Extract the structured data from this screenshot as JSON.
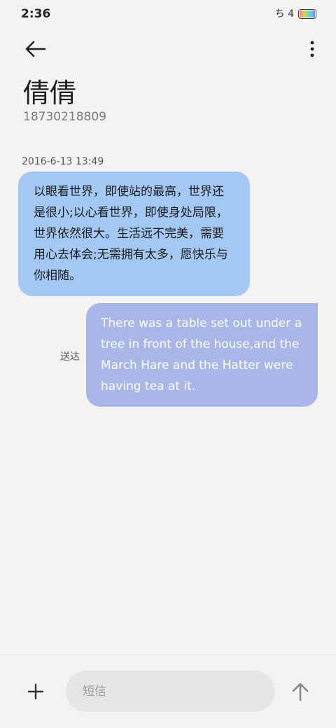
{
  "status_bar": {
    "time": "2:36",
    "indicators": "ち 4"
  },
  "header": {
    "back_icon": "arrow-left-icon",
    "menu_icon": "more-vertical-icon",
    "contact_name": "倩倩",
    "contact_number": "18730218809"
  },
  "conversation": {
    "timestamp": "2016-6-13 13:49",
    "received_message": "以眼看世界，即使站的最高，世界还是很小;以心看世界，即使身处局限，世界依然很大。生活远不完美，需要用心去体会;无需拥有太多，愿快乐与你相随。",
    "sent_message": "There was a table set out under a tree in front of the house,and the March Hare and the Hatter were having tea at it.",
    "sent_status": "送达"
  },
  "composer": {
    "placeholder": "短信",
    "add_icon": "plus-icon",
    "send_icon": "arrow-up-icon"
  },
  "colors": {
    "background": "#f4f3f1",
    "received_bubble": "#a3c8f3",
    "sent_bubble": "#a8b7e8",
    "input_background": "#e6e5e3"
  }
}
